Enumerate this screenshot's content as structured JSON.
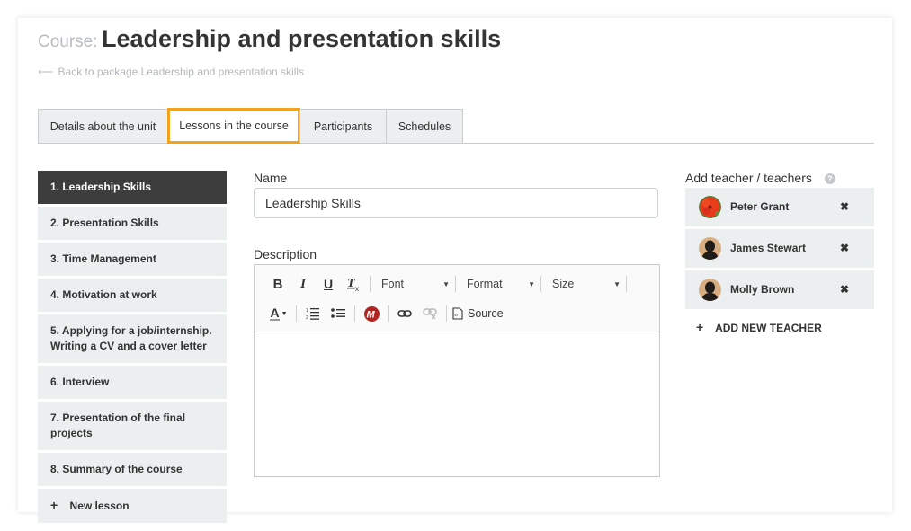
{
  "header": {
    "title_prefix": "Course:",
    "title": "Leadership and presentation skills",
    "back_arrow": "⟵",
    "back_link": "Back to package Leadership and presentation skills"
  },
  "tabs": [
    {
      "label": "Details about the unit",
      "active": false
    },
    {
      "label": "Lessons in the course",
      "active": true
    },
    {
      "label": "Participants",
      "active": false
    },
    {
      "label": "Schedules",
      "active": false
    }
  ],
  "lessons": [
    {
      "label": "1. Leadership Skills",
      "active": true
    },
    {
      "label": "2. Presentation Skills"
    },
    {
      "label": "3. Time Management"
    },
    {
      "label": "4. Motivation at work"
    },
    {
      "label": "5. Applying for a job/internship. Writing a CV and a cover letter"
    },
    {
      "label": "6. Interview"
    },
    {
      "label": "7. Presentation of the final projects"
    },
    {
      "label": "8. Summary of the course"
    }
  ],
  "new_lesson": {
    "icon": "+",
    "label": "New lesson"
  },
  "form": {
    "name_label": "Name",
    "name_value": "Leadership Skills",
    "description_label": "Description",
    "description_value": ""
  },
  "editor_toolbar": {
    "bold": "B",
    "italic": "I",
    "underline": "U",
    "clear_format": "T",
    "font": "Font",
    "format": "Format",
    "size": "Size",
    "text_color": "A",
    "source": "Source"
  },
  "teachers": {
    "label": "Add teacher / teachers",
    "help": "?",
    "items": [
      {
        "name": "Peter Grant",
        "avatar": "flower-photo",
        "remove": "✖"
      },
      {
        "name": "James Stewart",
        "avatar": "default-silhouette",
        "remove": "✖"
      },
      {
        "name": "Molly Brown",
        "avatar": "default-silhouette",
        "remove": "✖"
      }
    ],
    "add_icon": "+",
    "add_label": "ADD NEW TEACHER"
  },
  "colors": {
    "accent_tab_border": "#f2a31b",
    "active_lesson_bg": "#3d3d3d",
    "item_bg": "#eceff0",
    "mathtype_red": "#b3231f"
  }
}
